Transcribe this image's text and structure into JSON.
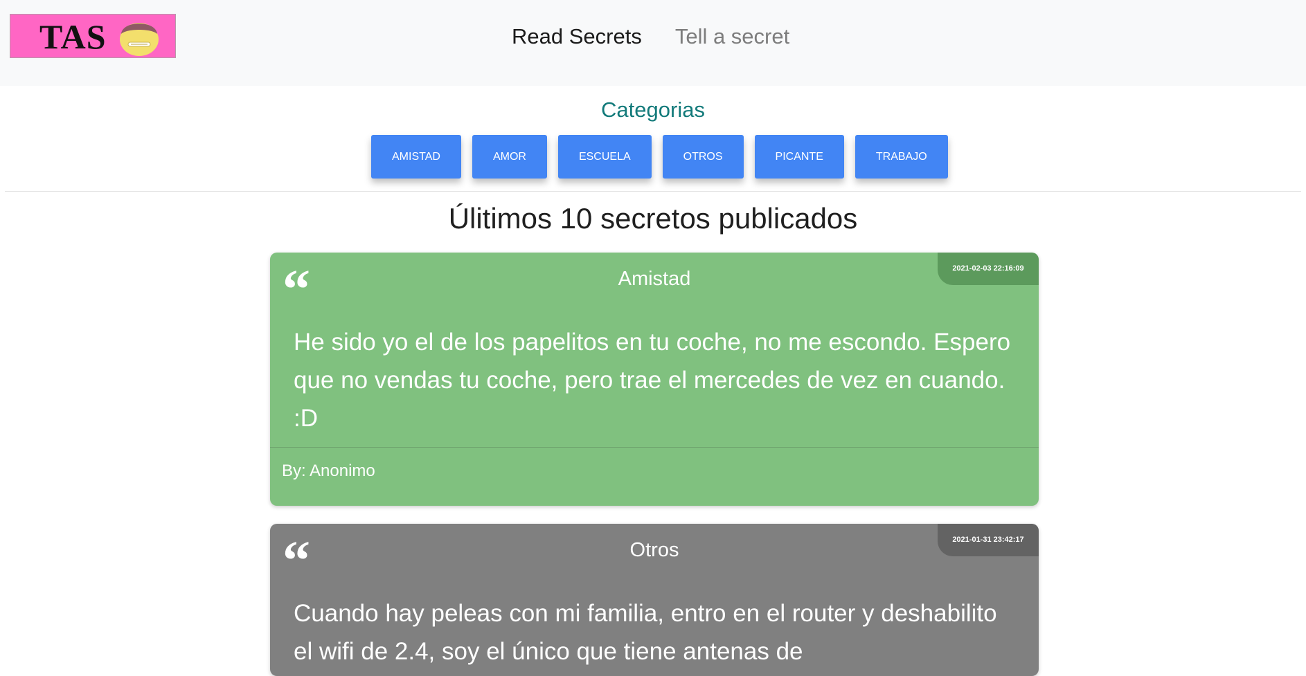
{
  "brand": {
    "logo_text": "TAS",
    "logo_icon": "zipped-mouth-face-icon"
  },
  "nav": {
    "items": [
      {
        "label": "Read Secrets"
      },
      {
        "label": "Tell a secret"
      }
    ]
  },
  "categories": {
    "title": "Categorias",
    "buttons": [
      {
        "label": "AMISTAD"
      },
      {
        "label": "AMOR"
      },
      {
        "label": "ESCUELA"
      },
      {
        "label": "OTROS"
      },
      {
        "label": "PICANTE"
      },
      {
        "label": "TRABAJO"
      }
    ]
  },
  "latest": {
    "title": "Úlitimos 10 secretos publicados"
  },
  "secrets": [
    {
      "category": "Amistad",
      "date": "2021-02-03 22:16:09",
      "text": "He sido yo el de los papelitos en tu coche, no me escondo. Espero que no vendas tu coche, pero trae el mercedes de vez en cuando. :D",
      "author": "By: Anonimo",
      "color": "#80c17f"
    },
    {
      "category": "Otros",
      "date": "2021-01-31 23:42:17",
      "text": "Cuando hay peleas con mi familia, entro en el router y deshabilito el wifi de 2.4, soy el único que tiene antenas de",
      "color": "#808080"
    }
  ],
  "quote_glyph": "“",
  "colors": {
    "accent": "#4285f4",
    "heading_teal": "#127a7a",
    "logo_bg": "#ff66c4"
  }
}
